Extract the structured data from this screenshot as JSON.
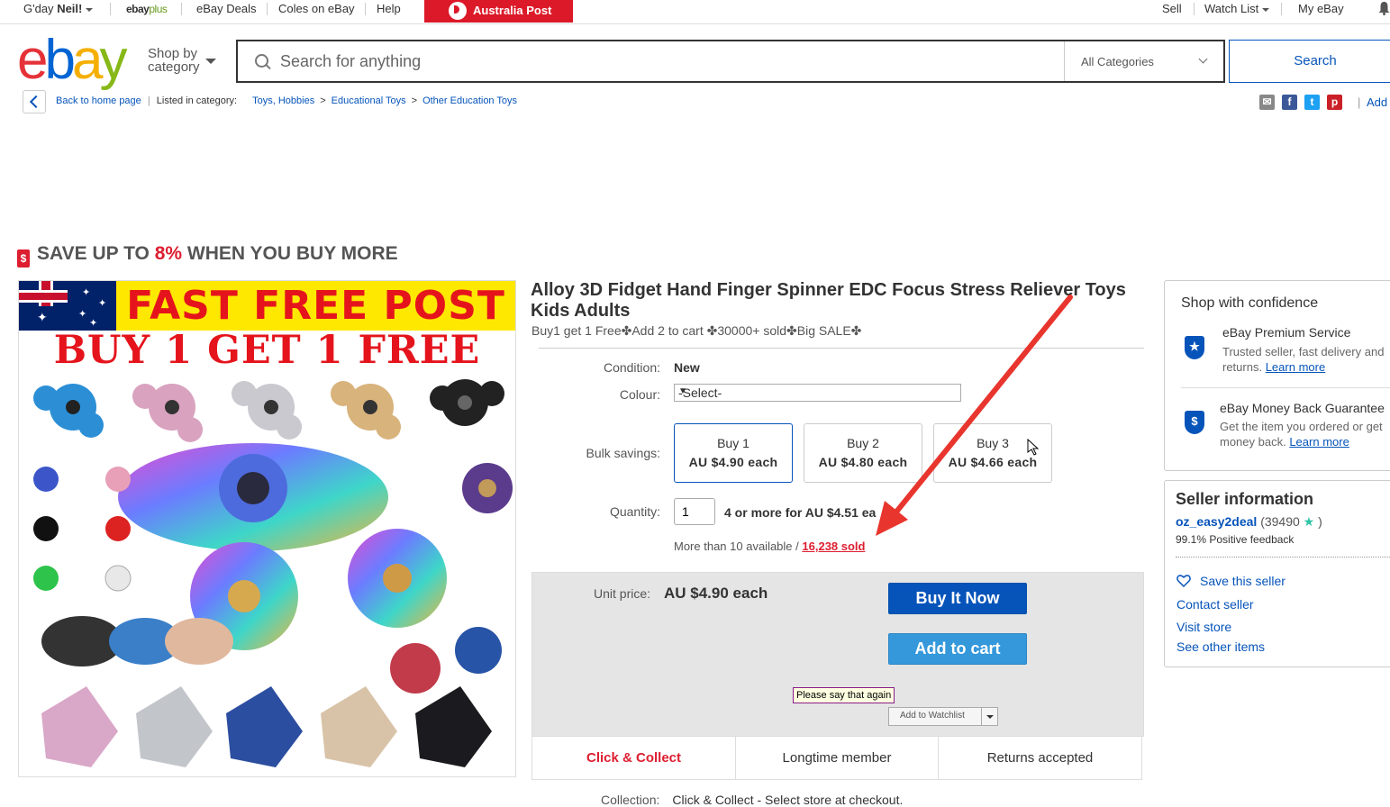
{
  "topnav": {
    "greeting_prefix": "G'day",
    "greeting_name": "Neil!",
    "ebayplus_ebay": "ebay",
    "ebayplus_plus": "plus",
    "deals": "eBay Deals",
    "coles": "Coles on eBay",
    "help": "Help",
    "auspost": "Australia Post",
    "sell": "Sell",
    "watchlist": "Watch List",
    "myebay": "My eBay"
  },
  "header": {
    "logo": [
      "e",
      "b",
      "a",
      "y"
    ],
    "shop_by_line1": "Shop by",
    "shop_by_line2": "category",
    "search_placeholder": "Search for anything",
    "category": "All Categories",
    "search_button": "Search"
  },
  "breadcrumb": {
    "back": "Back to home page",
    "listed_in": "Listed in category:",
    "items": [
      "Toys, Hobbies",
      "Educational Toys",
      "Other Education Toys"
    ],
    "sep": ">",
    "add": "Add"
  },
  "share_icons": [
    {
      "name": "email",
      "glyph": "✉",
      "color": "#888888"
    },
    {
      "name": "facebook",
      "glyph": "f",
      "color": "#3b5998"
    },
    {
      "name": "twitter",
      "glyph": "t",
      "color": "#1da1f2"
    },
    {
      "name": "pinterest",
      "glyph": "p",
      "color": "#cb2027"
    }
  ],
  "banner": {
    "icon": "$",
    "prefix": "SAVE UP TO ",
    "pct": "8%",
    "suffix": " WHEN YOU BUY MORE"
  },
  "image": {
    "headline": "FAST FREE POST",
    "promo": "BUY 1 GET 1 FREE"
  },
  "product": {
    "title": "Alloy 3D Fidget Hand Finger Spinner EDC Focus Stress Reliever Toys Kids Adults",
    "subtitle": "Buy1 get 1 Free✤Add 2 to cart ✤30000+ sold✤Big SALE✤",
    "condition_label": "Condition:",
    "condition": "New",
    "colour_label": "Colour:",
    "colour_value": "-Select-",
    "bulk_label": "Bulk savings:",
    "bulk": [
      {
        "qty": "Buy 1",
        "price": "AU $4.90 each"
      },
      {
        "qty": "Buy 2",
        "price": "AU $4.80 each"
      },
      {
        "qty": "Buy 3",
        "price": "AU $4.66 each"
      }
    ],
    "quantity_label": "Quantity:",
    "quantity": "1",
    "quantity_note": "4 or more for AU $4.51 ea",
    "available": "More than 10 available /",
    "sold": "16,238 sold",
    "unit_label": "Unit price:",
    "unit_price": "AU $4.90 each",
    "buy_now": "Buy It Now",
    "add_to_cart": "Add to cart",
    "tooltip": "Please say that again",
    "watchlist": "Add to Watchlist",
    "features": [
      "Click & Collect",
      "Longtime member",
      "Returns accepted"
    ],
    "collection_label": "Collection:",
    "collection_value": "Click & Collect - Select store at checkout."
  },
  "confidence": {
    "title": "Shop with confidence",
    "premium_title": "eBay Premium Service",
    "premium_line1": "Trusted seller, fast delivery and",
    "premium_line2": "returns.",
    "premium_link": "Learn more",
    "mbg_title": "eBay Money Back Guarantee",
    "mbg_line1": "Get the item you ordered or get",
    "mbg_line2": "money back.",
    "mbg_link": "Learn more",
    "premium_icon": "★",
    "mbg_icon": "$"
  },
  "seller": {
    "title": "Seller information",
    "name": "oz_easy2deal",
    "score": "(39490",
    "score_close": ")",
    "star": "★",
    "feedback": "99.1% Positive feedback",
    "save": "Save this seller",
    "contact": "Contact seller",
    "store": "Visit store",
    "other": "See other items"
  }
}
